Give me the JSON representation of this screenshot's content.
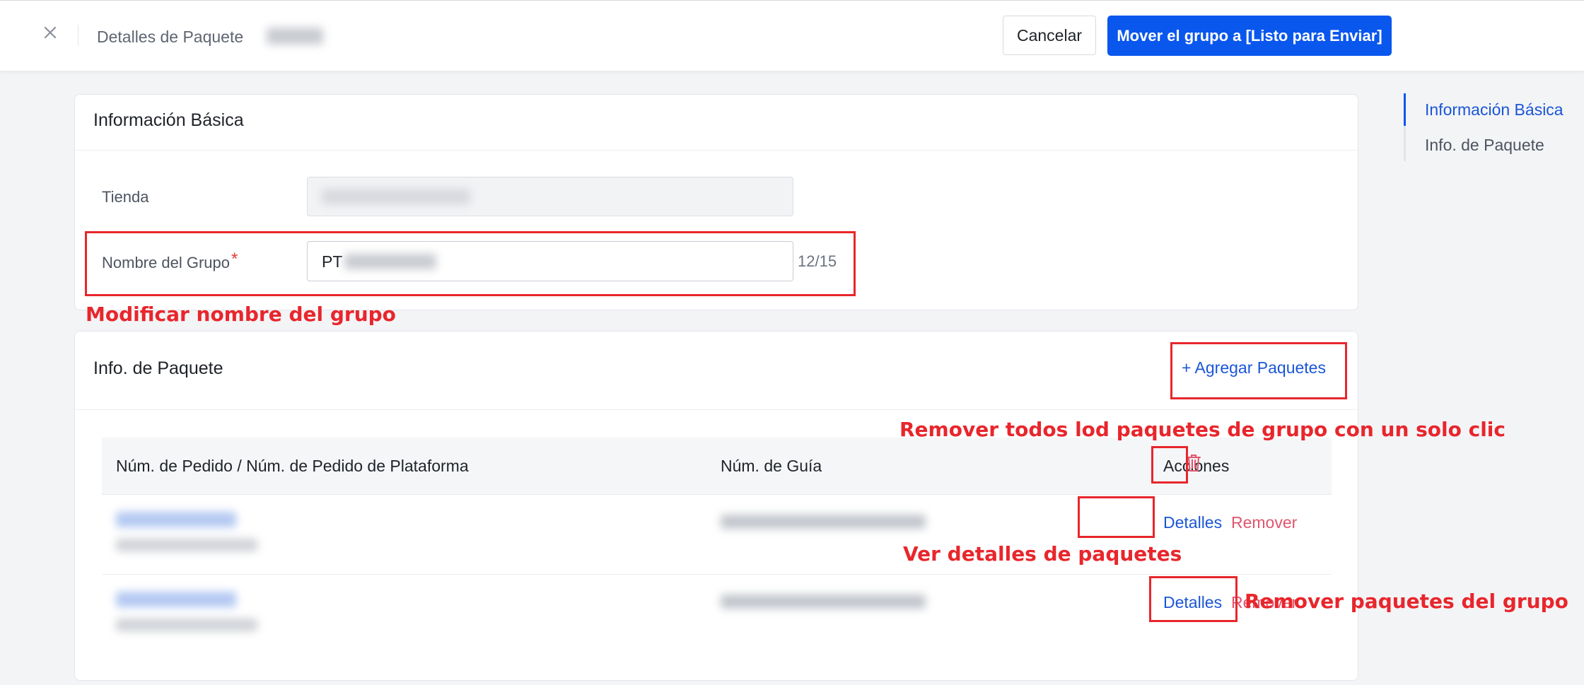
{
  "header": {
    "title": "Detalles de Paquete",
    "cancel_label": "Cancelar",
    "primary_label": "Mover el grupo a [Listo para Enviar]"
  },
  "basic_info": {
    "title": "Información Básica",
    "store_label": "Tienda",
    "group_name_label": "Nombre del Grupo",
    "required_mark": "*",
    "group_name_value": "PT",
    "counter": "12/15"
  },
  "package_info": {
    "title": "Info. de Paquete",
    "add_label": "+ Agregar Paquetes",
    "columns": [
      "Núm. de Pedido / Núm. de Pedido de Plataforma",
      "Núm. de Guía",
      "Acciones"
    ],
    "rows": [
      {
        "details_label": "Detalles",
        "remove_label": "Remover"
      },
      {
        "details_label": "Detalles",
        "remove_label": "Remover"
      }
    ]
  },
  "annotations": {
    "modify_name": "Modificar nombre del grupo",
    "remove_all": "Remover todos lod paquetes de grupo con un solo clic",
    "view_details": "Ver detalles de paquetes",
    "remove_package": "Remover paquetes del grupo"
  },
  "right_nav": {
    "items": [
      {
        "label": "Información Básica",
        "active": true
      },
      {
        "label": "Info. de Paquete",
        "active": false
      }
    ]
  },
  "colors": {
    "primary": "#0a57ee",
    "link": "#1a56d6",
    "remove": "#e0566e",
    "annotation": "#e8262c"
  },
  "icons": {
    "close": "close-icon",
    "trash": "trash-icon"
  }
}
